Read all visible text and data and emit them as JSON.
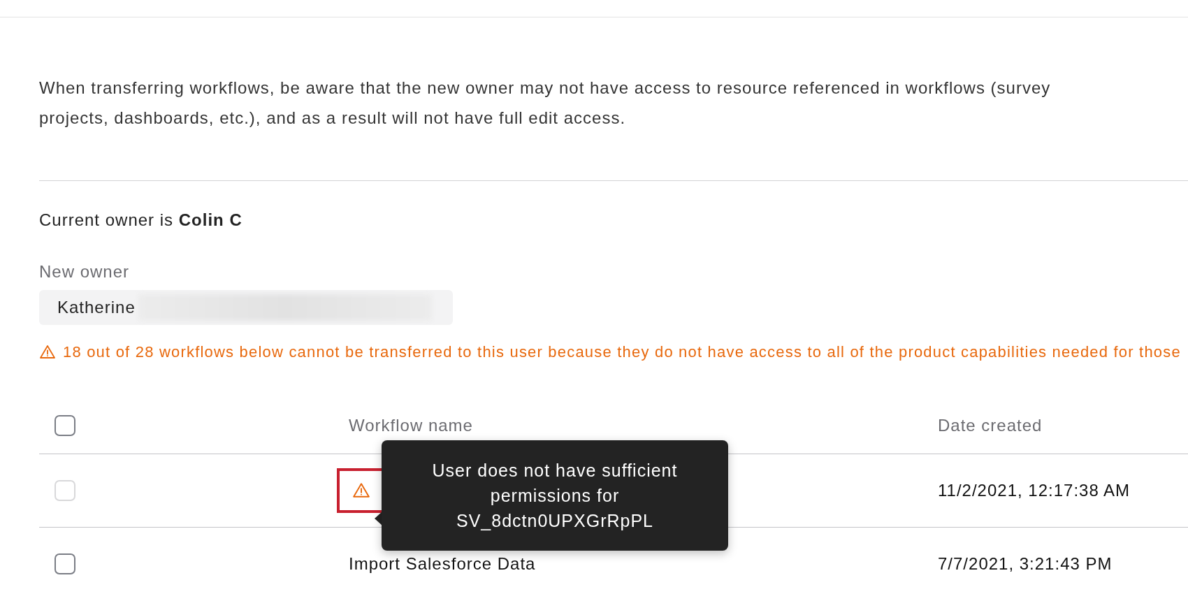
{
  "notice": "When transferring workflows, be aware that the new owner may not have access to resource referenced in workflows (survey projects, dashboards, etc.), and as a result will not have full edit access.",
  "current_owner": "Current owner is **Colin C**",
  "new_owner": {
    "label": "New owner",
    "value": "Katherine"
  },
  "warning": "18 out of 28 workflows below cannot be transferred to this user because they do not have access to all of the product capabilities needed for those",
  "table": {
    "select_all": {
      "checked": false
    },
    "columns": [
      "Workflow name",
      "Date created"
    ],
    "rows": [
      {
        "checked": false,
        "disabled": true,
        "warning": true,
        "highlighted": true,
        "date": "11/2/2021, 12:17:38 AM"
      },
      {
        "checked": false,
        "disabled": false,
        "warning": false,
        "highlighted": false,
        "name": "Import Salesforce Data",
        "date": "7/7/2021, 3:21:43 PM"
      }
    ]
  },
  "tooltip": {
    "lines": [
      "User does not have sufficient",
      "permissions for",
      "SV_8dctn0UPXGrRpPL"
    ]
  }
}
